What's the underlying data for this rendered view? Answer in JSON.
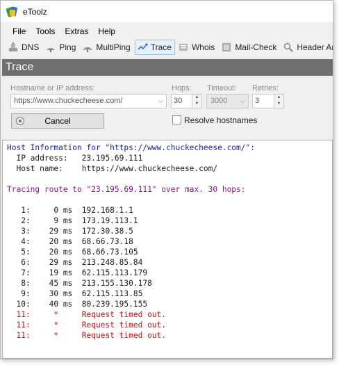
{
  "window": {
    "title": "eToolz"
  },
  "menu": [
    "File",
    "Tools",
    "Extras",
    "Help"
  ],
  "toolbar": [
    {
      "label": "DNS",
      "icon": "dns-icon",
      "active": false
    },
    {
      "label": "Ping",
      "icon": "ping-icon",
      "active": false
    },
    {
      "label": "MultiPing",
      "icon": "multiping-icon",
      "active": false
    },
    {
      "label": "Trace",
      "icon": "trace-icon",
      "active": true
    },
    {
      "label": "Whois",
      "icon": "whois-icon",
      "active": false
    },
    {
      "label": "Mail-Check",
      "icon": "mail-check-icon",
      "active": false
    },
    {
      "label": "Header Analy",
      "icon": "header-analyzer-icon",
      "active": false
    }
  ],
  "section": {
    "title": "Trace"
  },
  "form": {
    "host_label": "Hostname or IP address:",
    "host_value": "https://www.chuckecheese.com/",
    "hops_label": "Hops:",
    "hops_value": "30",
    "timeout_label": "Timeout:",
    "timeout_value": "3000",
    "retries_label": "Retries:",
    "retries_value": "3",
    "cancel_label": "Cancel",
    "resolve_label": "Resolve hostnames",
    "resolve_checked": false
  },
  "output": {
    "lines": [
      {
        "text": "Host Information for \"https://www.chuckecheese.com/\":",
        "color": "blue"
      },
      {
        "text": "  IP address:   23.195.69.111",
        "color": "dark"
      },
      {
        "text": "  Host name:    https://www.chuckecheese.com/",
        "color": "dark"
      },
      {
        "text": "",
        "color": "dark"
      },
      {
        "text": "Tracing route to \"23.195.69.111\" over max. 30 hops:",
        "color": "purple"
      },
      {
        "text": "",
        "color": "dark"
      },
      {
        "text": "   1:     0 ms  192.168.1.1",
        "color": "dark"
      },
      {
        "text": "   2:     9 ms  173.19.113.1",
        "color": "dark"
      },
      {
        "text": "   3:    29 ms  172.30.38.5",
        "color": "dark"
      },
      {
        "text": "   4:    20 ms  68.66.73.18",
        "color": "dark"
      },
      {
        "text": "   5:    20 ms  68.66.73.105",
        "color": "dark"
      },
      {
        "text": "   6:    29 ms  213.248.85.84",
        "color": "dark"
      },
      {
        "text": "   7:    19 ms  62.115.113.179",
        "color": "dark"
      },
      {
        "text": "   8:    45 ms  213.155.130.178",
        "color": "dark"
      },
      {
        "text": "   9:    30 ms  62.115.113.85",
        "color": "dark"
      },
      {
        "text": "  10:    40 ms  80.239.195.155",
        "color": "dark"
      },
      {
        "text": "  11:     *     Request timed out.",
        "color": "red"
      },
      {
        "text": "  11:     *     Request timed out.",
        "color": "red"
      },
      {
        "text": "  11:     *     Request timed out.",
        "color": "red"
      }
    ]
  }
}
